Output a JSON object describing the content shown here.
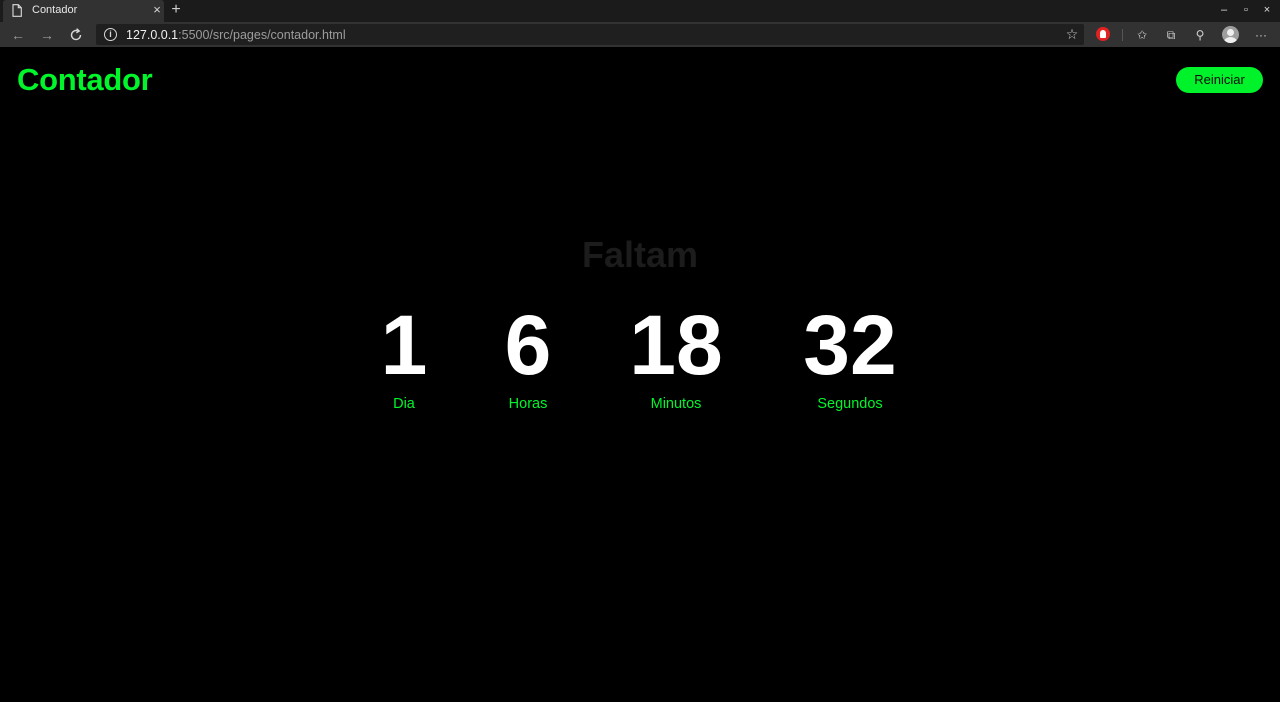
{
  "browser": {
    "tab_title": "Contador",
    "tab_close": "×",
    "new_tab": "+",
    "url_host": "127.0.0.1",
    "url_rest": ":5500/src/pages/contador.html",
    "window_controls": [
      "–",
      "▫",
      "×"
    ]
  },
  "header": {
    "logo": "Contador",
    "restart_label": "Reiniciar"
  },
  "countdown": {
    "headline": "Faltam",
    "units": [
      {
        "value": "1",
        "label": "Dia"
      },
      {
        "value": "6",
        "label": "Horas"
      },
      {
        "value": "18",
        "label": "Minutos"
      },
      {
        "value": "32",
        "label": "Segundos"
      }
    ]
  },
  "colors": {
    "accent": "#00f62a",
    "background": "#000000",
    "value_text": "#ffffff",
    "headline_text": "#1c1c1c"
  },
  "icons": [
    "page-icon",
    "back-arrow-icon",
    "forward-arrow-icon",
    "reload-icon",
    "info-icon",
    "star-icon",
    "extension-icon",
    "favorites-icon",
    "collections-icon",
    "share-icon",
    "profile-avatar-icon",
    "more-menu-icon"
  ]
}
